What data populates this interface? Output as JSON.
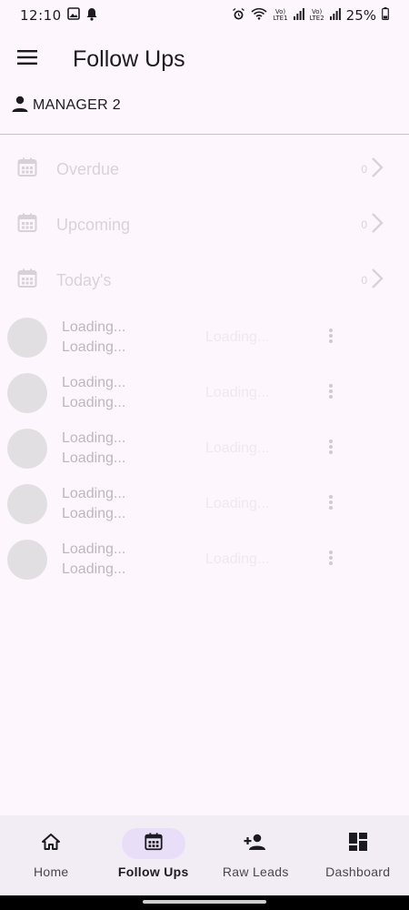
{
  "status_bar": {
    "time": "12:10",
    "net_label_1": "Vo)\nLTE1",
    "net_label_2": "Vo)\nLTE2",
    "battery": "25%"
  },
  "app_bar": {
    "title": "Follow Ups",
    "menu_icon": "menu-icon"
  },
  "user": {
    "name": "MANAGER 2",
    "icon": "person-icon"
  },
  "summary": [
    {
      "label": "Overdue",
      "count": "0"
    },
    {
      "label": "Upcoming",
      "count": "0"
    },
    {
      "label": "Today's",
      "count": "0"
    }
  ],
  "loading_rows": [
    {
      "line1": "Loading...",
      "line2": "Loading...",
      "status": "Loading..."
    },
    {
      "line1": "Loading...",
      "line2": "Loading...",
      "status": "Loading..."
    },
    {
      "line1": "Loading...",
      "line2": "Loading...",
      "status": "Loading..."
    },
    {
      "line1": "Loading...",
      "line2": "Loading...",
      "status": "Loading..."
    },
    {
      "line1": "Loading...",
      "line2": "Loading...",
      "status": "Loading..."
    }
  ],
  "bottom_nav": [
    {
      "label": "Home",
      "icon": "home-icon"
    },
    {
      "label": "Follow Ups",
      "icon": "calendar-icon",
      "active": true
    },
    {
      "label": "Raw Leads",
      "icon": "person-add-icon"
    },
    {
      "label": "Dashboard",
      "icon": "dashboard-icon"
    }
  ],
  "colors": {
    "background": "#fdf7fd",
    "nav_background": "#f2ecf4",
    "active_indicator": "#e8def8",
    "text": "#1c1b1f"
  }
}
